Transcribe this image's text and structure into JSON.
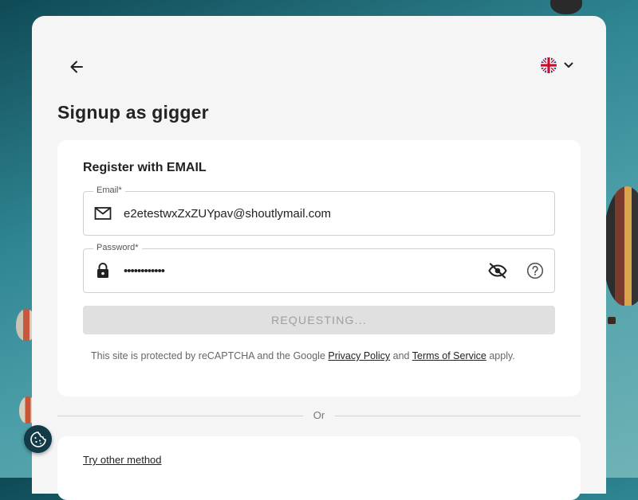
{
  "header": {
    "back_icon": "arrow-left-icon",
    "language_icon": "uk-flag-icon",
    "language_dropdown_icon": "chevron-down-icon"
  },
  "page_title": "Signup as gigger",
  "form": {
    "title": "Register with EMAIL",
    "email": {
      "label": "Email*",
      "value": "e2etestwxZxZUYpav@shoutlymail.com",
      "icon": "mail-icon"
    },
    "password": {
      "label": "Password*",
      "value": "••••••••••••",
      "icon": "lock-icon",
      "visibility_icon": "eye-off-icon",
      "help_icon": "question-circle-icon"
    },
    "submit_label": "REQUESTING...",
    "recaptcha": {
      "prefix": "This site is protected by reCAPTCHA and the Google",
      "privacy_link": "Privacy Policy",
      "and": "and",
      "terms_link": "Terms of Service",
      "suffix": "apply."
    }
  },
  "divider_text": "Or",
  "other_method_link": "Try other method",
  "cookie_icon": "cookie-icon"
}
